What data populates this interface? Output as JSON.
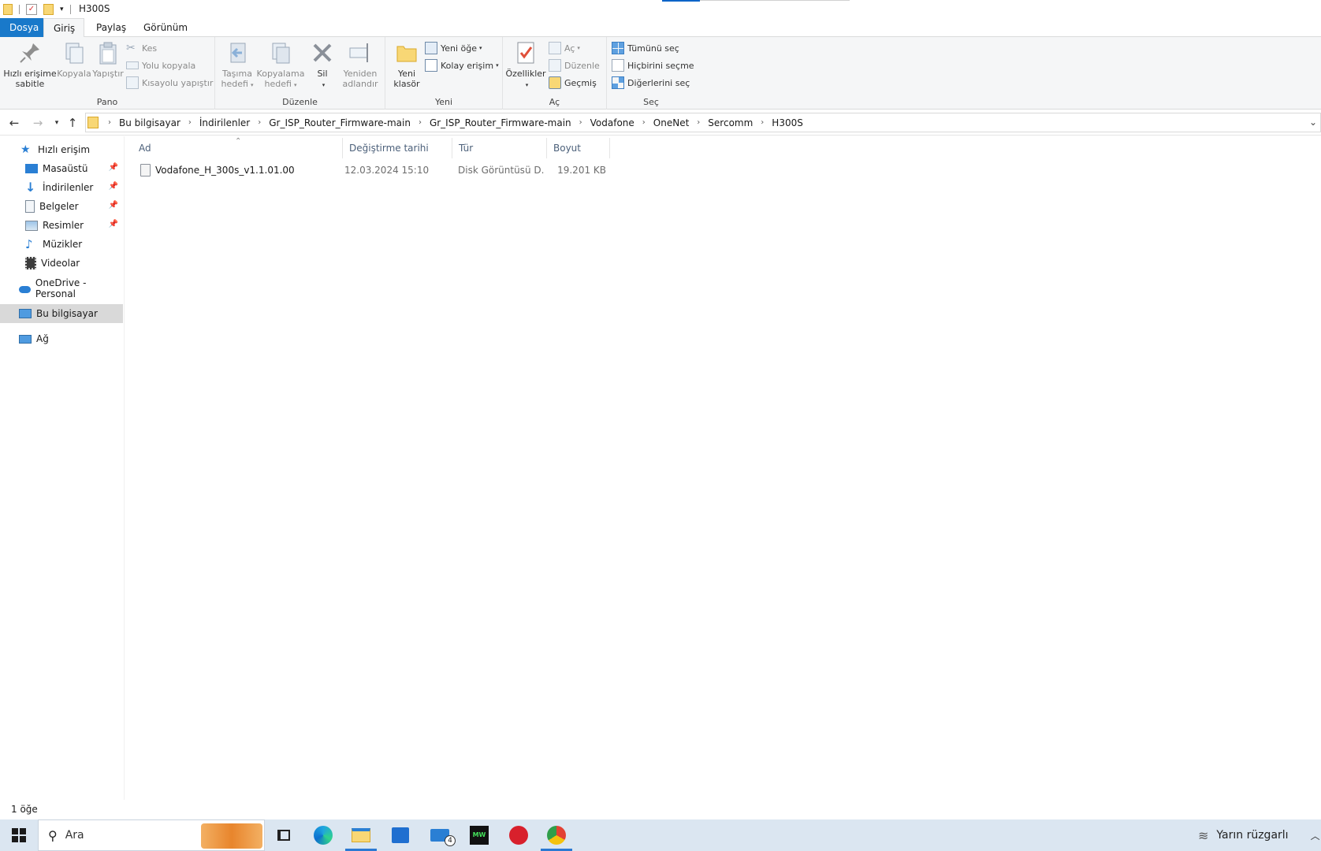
{
  "window": {
    "title": "H300S"
  },
  "ribbon_tabs": [
    "Dosya",
    "Giriş",
    "Paylaş",
    "Görünüm"
  ],
  "ribbon": {
    "pano": {
      "label": "Pano",
      "pin": "Hızlı erişime sabitle",
      "copy": "Kopyala",
      "paste": "Yapıştır",
      "cut": "Kes",
      "copy_path": "Yolu kopyala",
      "paste_shortcut": "Kısayolu yapıştır"
    },
    "duzenle": {
      "label": "Düzenle",
      "move_to": "Taşıma hedefi",
      "copy_to": "Kopyalama hedefi",
      "delete": "Sil",
      "rename": "Yeniden adlandır"
    },
    "yeni": {
      "label": "Yeni",
      "new_folder": "Yeni klasör",
      "new_item": "Yeni öğe",
      "easy_access": "Kolay erişim"
    },
    "ac": {
      "label": "Aç",
      "properties": "Özellikler",
      "open": "Aç",
      "edit": "Düzenle",
      "history": "Geçmiş"
    },
    "sec": {
      "label": "Seç",
      "select_all": "Tümünü seç",
      "select_none": "Hiçbirini seçme",
      "invert": "Diğerlerini seç"
    }
  },
  "breadcrumb": [
    "Bu bilgisayar",
    "İndirilenler",
    "Gr_ISP_Router_Firmware-main",
    "Gr_ISP_Router_Firmware-main",
    "Vodafone",
    "OneNet",
    "Sercomm",
    "H300S"
  ],
  "nav": {
    "quick_access": "Hızlı erişim",
    "items": [
      "Masaüstü",
      "İndirilenler",
      "Belgeler",
      "Resimler",
      "Müzikler",
      "Videolar"
    ],
    "onedrive": "OneDrive - Personal",
    "this_pc": "Bu bilgisayar",
    "network": "Ağ"
  },
  "columns": {
    "name": "Ad",
    "modified": "Değiştirme tarihi",
    "type": "Tür",
    "size": "Boyut"
  },
  "files": [
    {
      "name": "Vodafone_H_300s_v1.1.01.00",
      "modified": "12.03.2024 15:10",
      "type": "Disk Görüntüsü D...",
      "size": "19.201 KB"
    }
  ],
  "status": {
    "count": "1 öğe"
  },
  "taskbar": {
    "search_placeholder": "Ara",
    "mail_badge": "4",
    "weather": "Yarın rüzgarlı"
  },
  "colors": {
    "file_tab": "#1979ca",
    "ribbon_bg": "#f5f6f7",
    "taskbar_bg": "#dbe6f1",
    "selected_nav": "#d9d9d9"
  }
}
